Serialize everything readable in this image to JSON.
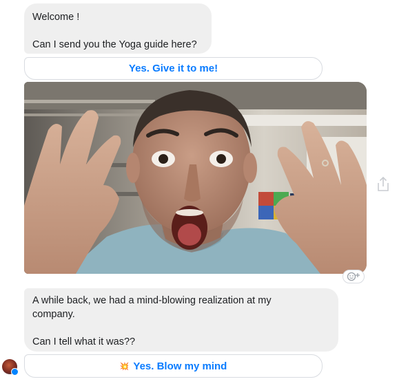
{
  "messages": {
    "welcome": {
      "line1": "Welcome !",
      "line2": "Can I send you the Yoga guide here?"
    },
    "story": {
      "line1": "A while back, we had a mind-blowing realization at my",
      "line2": "company.",
      "line3": "Can I tell what it was??"
    }
  },
  "quick_replies": {
    "first": "Yes. Give it to me!",
    "second": "Yes. Blow my mind",
    "second_emoji": "💥"
  },
  "icons": {
    "share": "share-icon",
    "react": "add-reaction-icon",
    "badge": "messenger-badge-icon"
  },
  "colors": {
    "bubble": "#efefef",
    "accent": "#0a7cff",
    "border": "#d8dbe0"
  }
}
